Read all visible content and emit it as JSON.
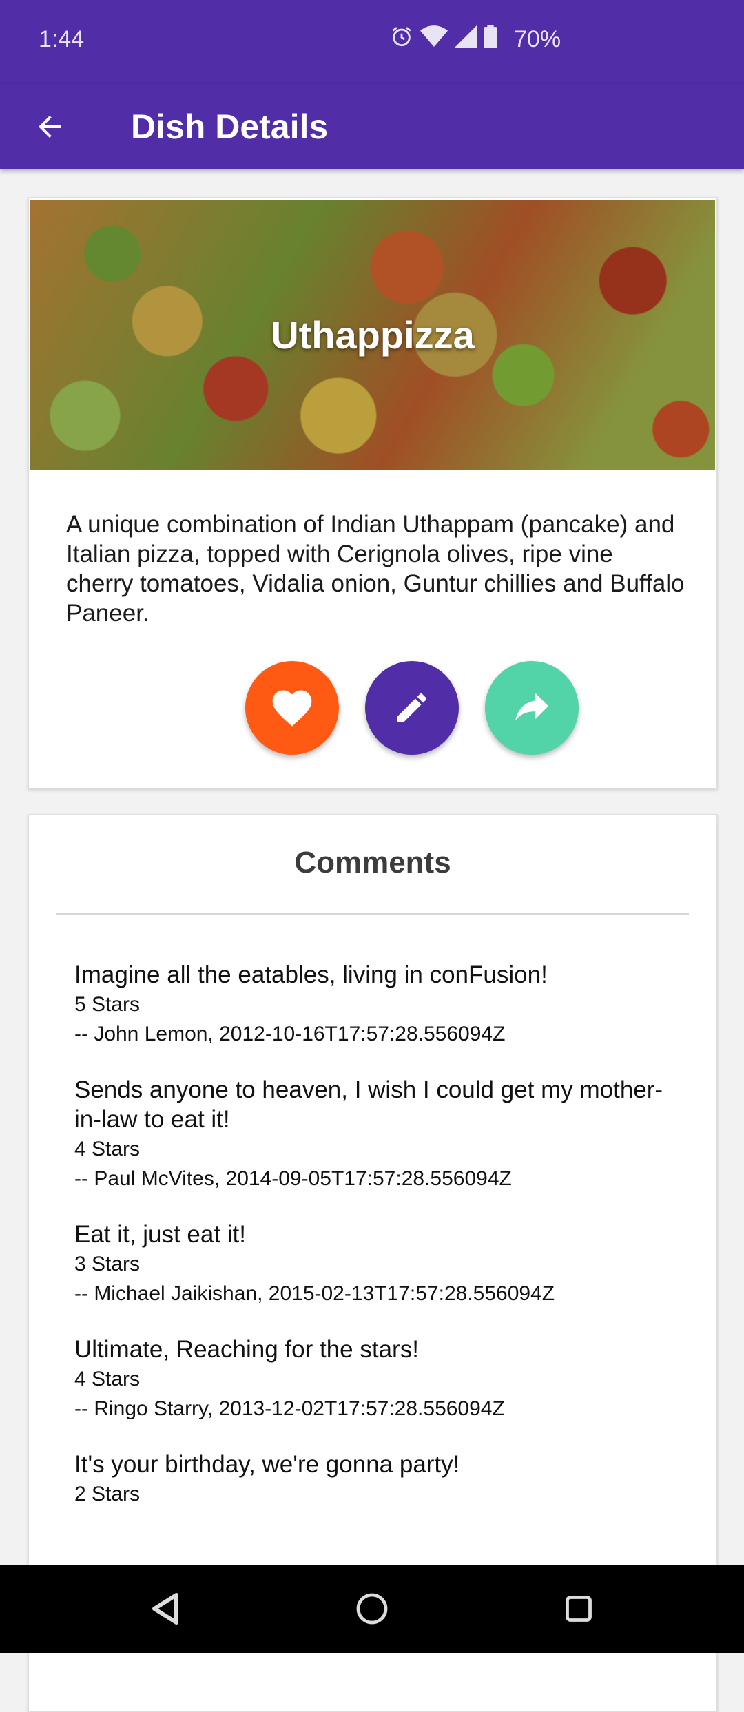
{
  "status_bar": {
    "time": "1:44",
    "battery": "70%",
    "icons": [
      "alarm-icon",
      "wifi-icon",
      "signal-icon",
      "battery-icon"
    ]
  },
  "app_bar": {
    "title": "Dish Details",
    "back_icon": "arrow-back-icon",
    "color": "#512da8"
  },
  "dish": {
    "name": "Uthappizza",
    "description": "A unique combination of Indian Uthappam (pancake) and Italian pizza, topped with Cerignola olives, ripe vine cherry tomatoes, Vidalia onion, Guntur chillies and Buffalo Paneer.",
    "actions": [
      {
        "icon": "heart-icon",
        "color": "#ff5a14"
      },
      {
        "icon": "pencil-icon",
        "color": "#512da8"
      },
      {
        "icon": "share-icon",
        "color": "#52d3a8"
      }
    ]
  },
  "comments": {
    "title": "Comments",
    "items": [
      {
        "text": "Imagine all the eatables, living in conFusion!",
        "rating": "5 Stars",
        "meta": "-- John Lemon, 2012-10-16T17:57:28.556094Z"
      },
      {
        "text": "Sends anyone to heaven, I wish I could get my mother-in-law to eat it!",
        "rating": "4 Stars",
        "meta": "-- Paul McVites, 2014-09-05T17:57:28.556094Z"
      },
      {
        "text": "Eat it, just eat it!",
        "rating": "3 Stars",
        "meta": "-- Michael Jaikishan, 2015-02-13T17:57:28.556094Z"
      },
      {
        "text": "Ultimate, Reaching for the stars!",
        "rating": "4 Stars",
        "meta": "-- Ringo Starry, 2013-12-02T17:57:28.556094Z"
      },
      {
        "text": "It's your birthday, we're gonna party!",
        "rating": "2 Stars",
        "meta": ""
      }
    ]
  },
  "nav_bar": {
    "buttons": [
      "back-triangle-icon",
      "home-circle-icon",
      "recents-square-icon"
    ]
  }
}
